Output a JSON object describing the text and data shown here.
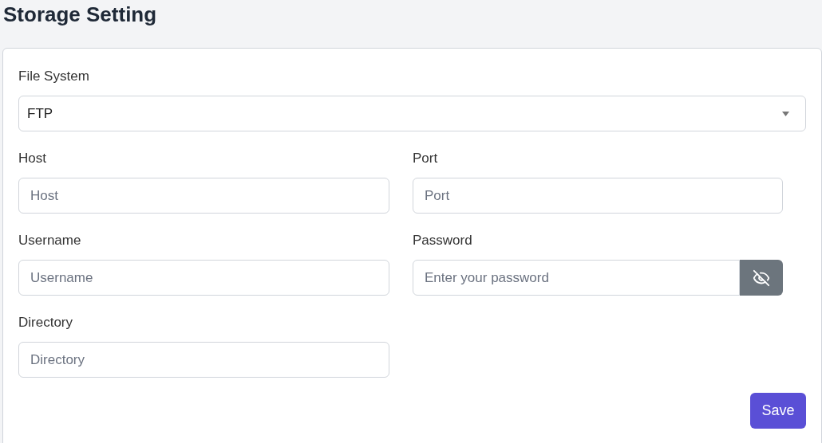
{
  "page_title": "Storage Setting",
  "file_system": {
    "label": "File System",
    "value": "FTP"
  },
  "fields": [
    {
      "kind": "text",
      "label": "Host",
      "placeholder": "Host"
    },
    {
      "kind": "text",
      "label": "Port",
      "placeholder": "Port"
    },
    {
      "kind": "text",
      "label": "Username",
      "placeholder": "Username"
    },
    {
      "kind": "password",
      "label": "Password",
      "placeholder": "Enter your password"
    },
    {
      "kind": "text",
      "label": "Directory",
      "placeholder": "Directory"
    }
  ],
  "save_button": "Save"
}
